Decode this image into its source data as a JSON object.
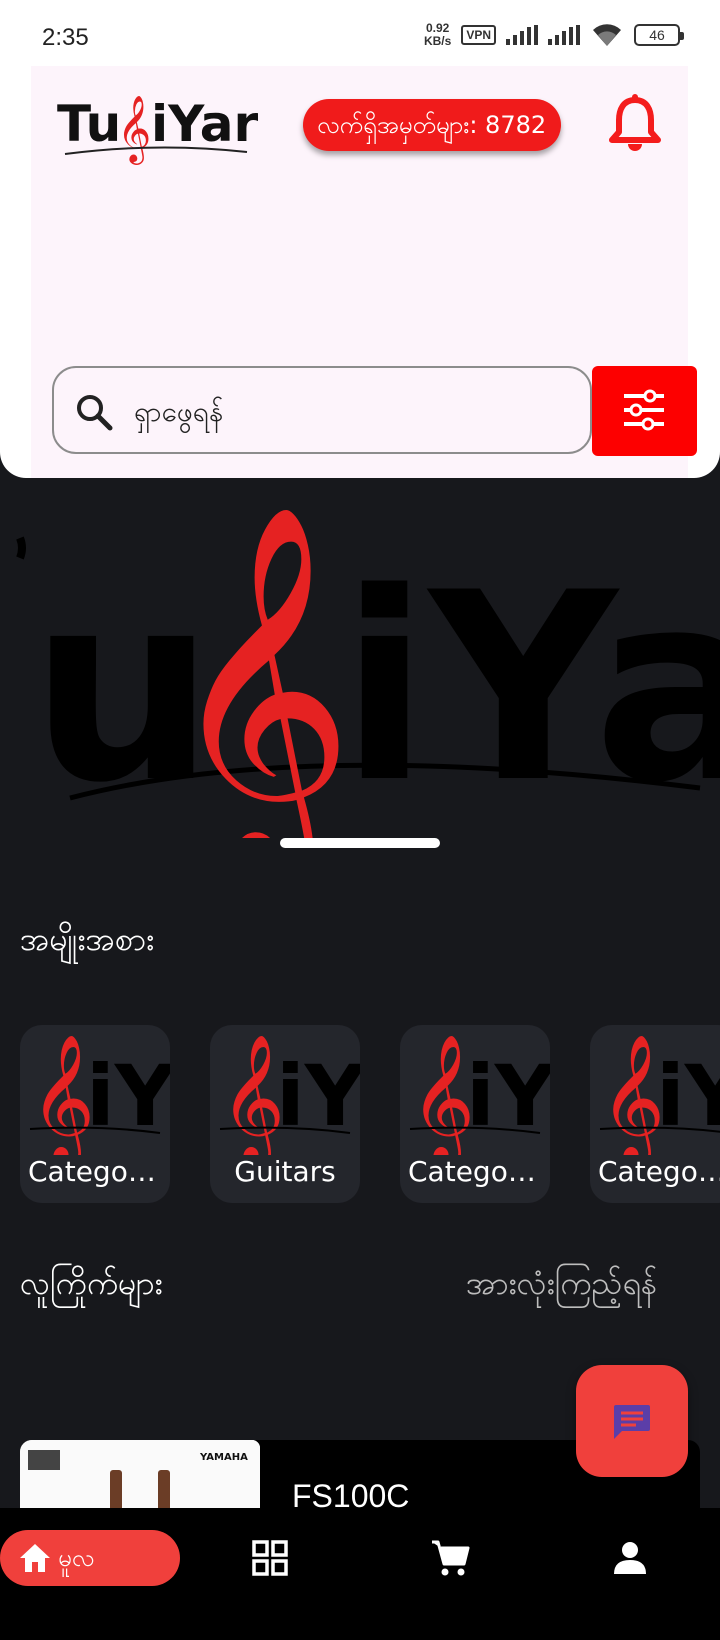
{
  "status_bar": {
    "time": "2:35",
    "net_speed_value": "0.92",
    "net_speed_unit": "KB/s",
    "vpn": "VPN",
    "battery": "46"
  },
  "header": {
    "logo_text": "TuiYar",
    "points_label": "လက်ရှိအမှတ်များ: 8782",
    "search_placeholder": "ရှာဖွေရန်"
  },
  "categories": {
    "title": "အမျိုးအစား",
    "items": [
      {
        "label": "Categor..."
      },
      {
        "label": "Guitars"
      },
      {
        "label": "Categor..."
      },
      {
        "label": "Categor..."
      }
    ]
  },
  "recommended": {
    "title": "လူကြိုက်များ",
    "see_all": "အားလုံးကြည့်ရန်",
    "products": [
      {
        "name": "FS100C",
        "brand": "YAMAHA"
      }
    ]
  },
  "bottom_nav": {
    "home_label": "မူလ",
    "items": [
      "home-icon",
      "grid-icon",
      "cart-icon",
      "profile-icon"
    ]
  },
  "colors": {
    "accent": "#f0403c",
    "badge": "#f01b1b",
    "filter": "#fd0000",
    "background": "#17181c"
  }
}
